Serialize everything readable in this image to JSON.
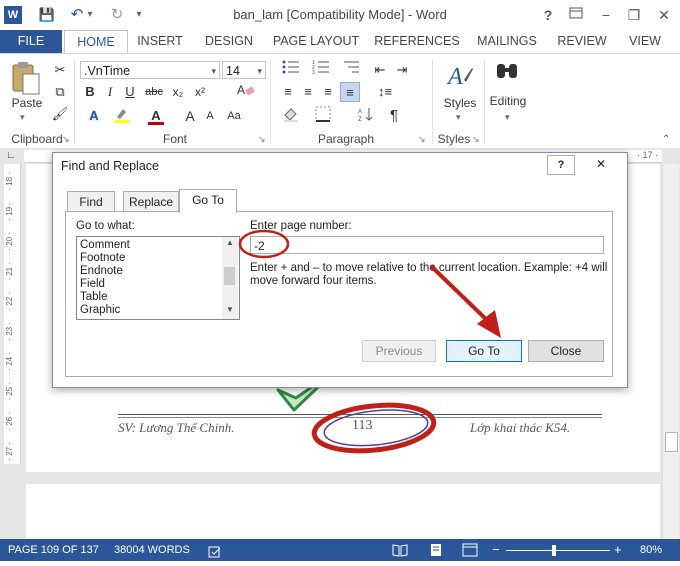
{
  "window": {
    "title": "ban_lam [Compatibility Mode] - Word",
    "help": "?",
    "min": "−",
    "restore": "❐",
    "close": "✕"
  },
  "qat": {
    "word_icon": "W",
    "save": "💾",
    "undo": "↶",
    "undo_drop": "▾",
    "redo": "↻",
    "customize": "▾"
  },
  "ribbon_tabs": [
    "FILE",
    "HOME",
    "INSERT",
    "DESIGN",
    "PAGE LAYOUT",
    "REFERENCES",
    "MAILINGS",
    "REVIEW",
    "VIEW"
  ],
  "clipboard": {
    "paste_label": "Paste",
    "paste_drop": "▾",
    "group_label": "Clipboard"
  },
  "font": {
    "name": ".VnTime",
    "size": "14",
    "group_label": "Font",
    "bold": "B",
    "italic": "I",
    "underline": "U",
    "strike": "abc",
    "sub": "x₂",
    "sup": "x²",
    "grow": "A",
    "shrink": "A",
    "aa": "Aa",
    "font_color": "A",
    "effects": "A"
  },
  "paragraph": {
    "group_label": "Paragraph",
    "pilcrow": "¶"
  },
  "styles": {
    "label": "Styles",
    "group_label": "Styles"
  },
  "editing": {
    "label": "Editing"
  },
  "ruler": {
    "ticks": [
      "· 18 ·",
      "· 19 ·",
      "· 20 ·",
      "· 21 ·",
      "· 22 ·",
      "· 23 ·",
      "· 24 ·",
      "· 25 ·",
      "· 26 ·",
      "· 27 ·"
    ],
    "top_right": "· 17 ·"
  },
  "document": {
    "footer_left": "SV: Lương Thế Chinh.",
    "page_number": "113",
    "footer_right": "Lớp khai thác K54."
  },
  "dialog": {
    "title": "Find and Replace",
    "help": "?",
    "close": "✕",
    "tabs": [
      "Find",
      "Replace",
      "Go To"
    ],
    "go_to_what_label": "Go to what:",
    "items": [
      "Comment",
      "Footnote",
      "Endnote",
      "Field",
      "Table",
      "Graphic"
    ],
    "enter_label": "Enter page number:",
    "input_value": "-2",
    "hint": "Enter + and – to move relative to the current location. Example: +4 will move forward four items.",
    "previous": "Previous",
    "goto": "Go To",
    "close_btn": "Close"
  },
  "status": {
    "page": "PAGE 109 OF 137",
    "words": "38004 WORDS",
    "zoom": "80%"
  },
  "colors": {
    "accent": "#2b579a",
    "annotation": "#c0201a",
    "check": "#2e8b3d"
  }
}
